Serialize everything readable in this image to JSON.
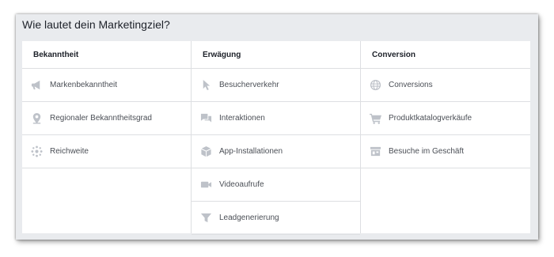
{
  "heading": "Wie lautet dein Marketingziel?",
  "columns": [
    {
      "title": "Bekanntheit",
      "items": [
        {
          "label": "Markenbekanntheit",
          "icon": "megaphone-icon"
        },
        {
          "label": "Regionaler Bekanntheitsgrad",
          "icon": "location-pin-icon"
        },
        {
          "label": "Reichweite",
          "icon": "reach-icon"
        }
      ]
    },
    {
      "title": "Erwägung",
      "items": [
        {
          "label": "Besucherverkehr",
          "icon": "cursor-icon"
        },
        {
          "label": "Interaktionen",
          "icon": "chat-bubbles-icon"
        },
        {
          "label": "App-Installationen",
          "icon": "cube-icon"
        },
        {
          "label": "Videoaufrufe",
          "icon": "video-camera-icon"
        },
        {
          "label": "Leadgenerierung",
          "icon": "funnel-icon"
        }
      ]
    },
    {
      "title": "Conversion",
      "items": [
        {
          "label": "Conversions",
          "icon": "globe-icon"
        },
        {
          "label": "Produktkatalogverkäufe",
          "icon": "shopping-cart-icon"
        },
        {
          "label": "Besuche im Geschäft",
          "icon": "store-icon"
        }
      ]
    }
  ],
  "colors": {
    "icon": "#bec2c9",
    "border": "#dddfe2",
    "panel": "#e9ebee",
    "text": "#4b4f56"
  }
}
